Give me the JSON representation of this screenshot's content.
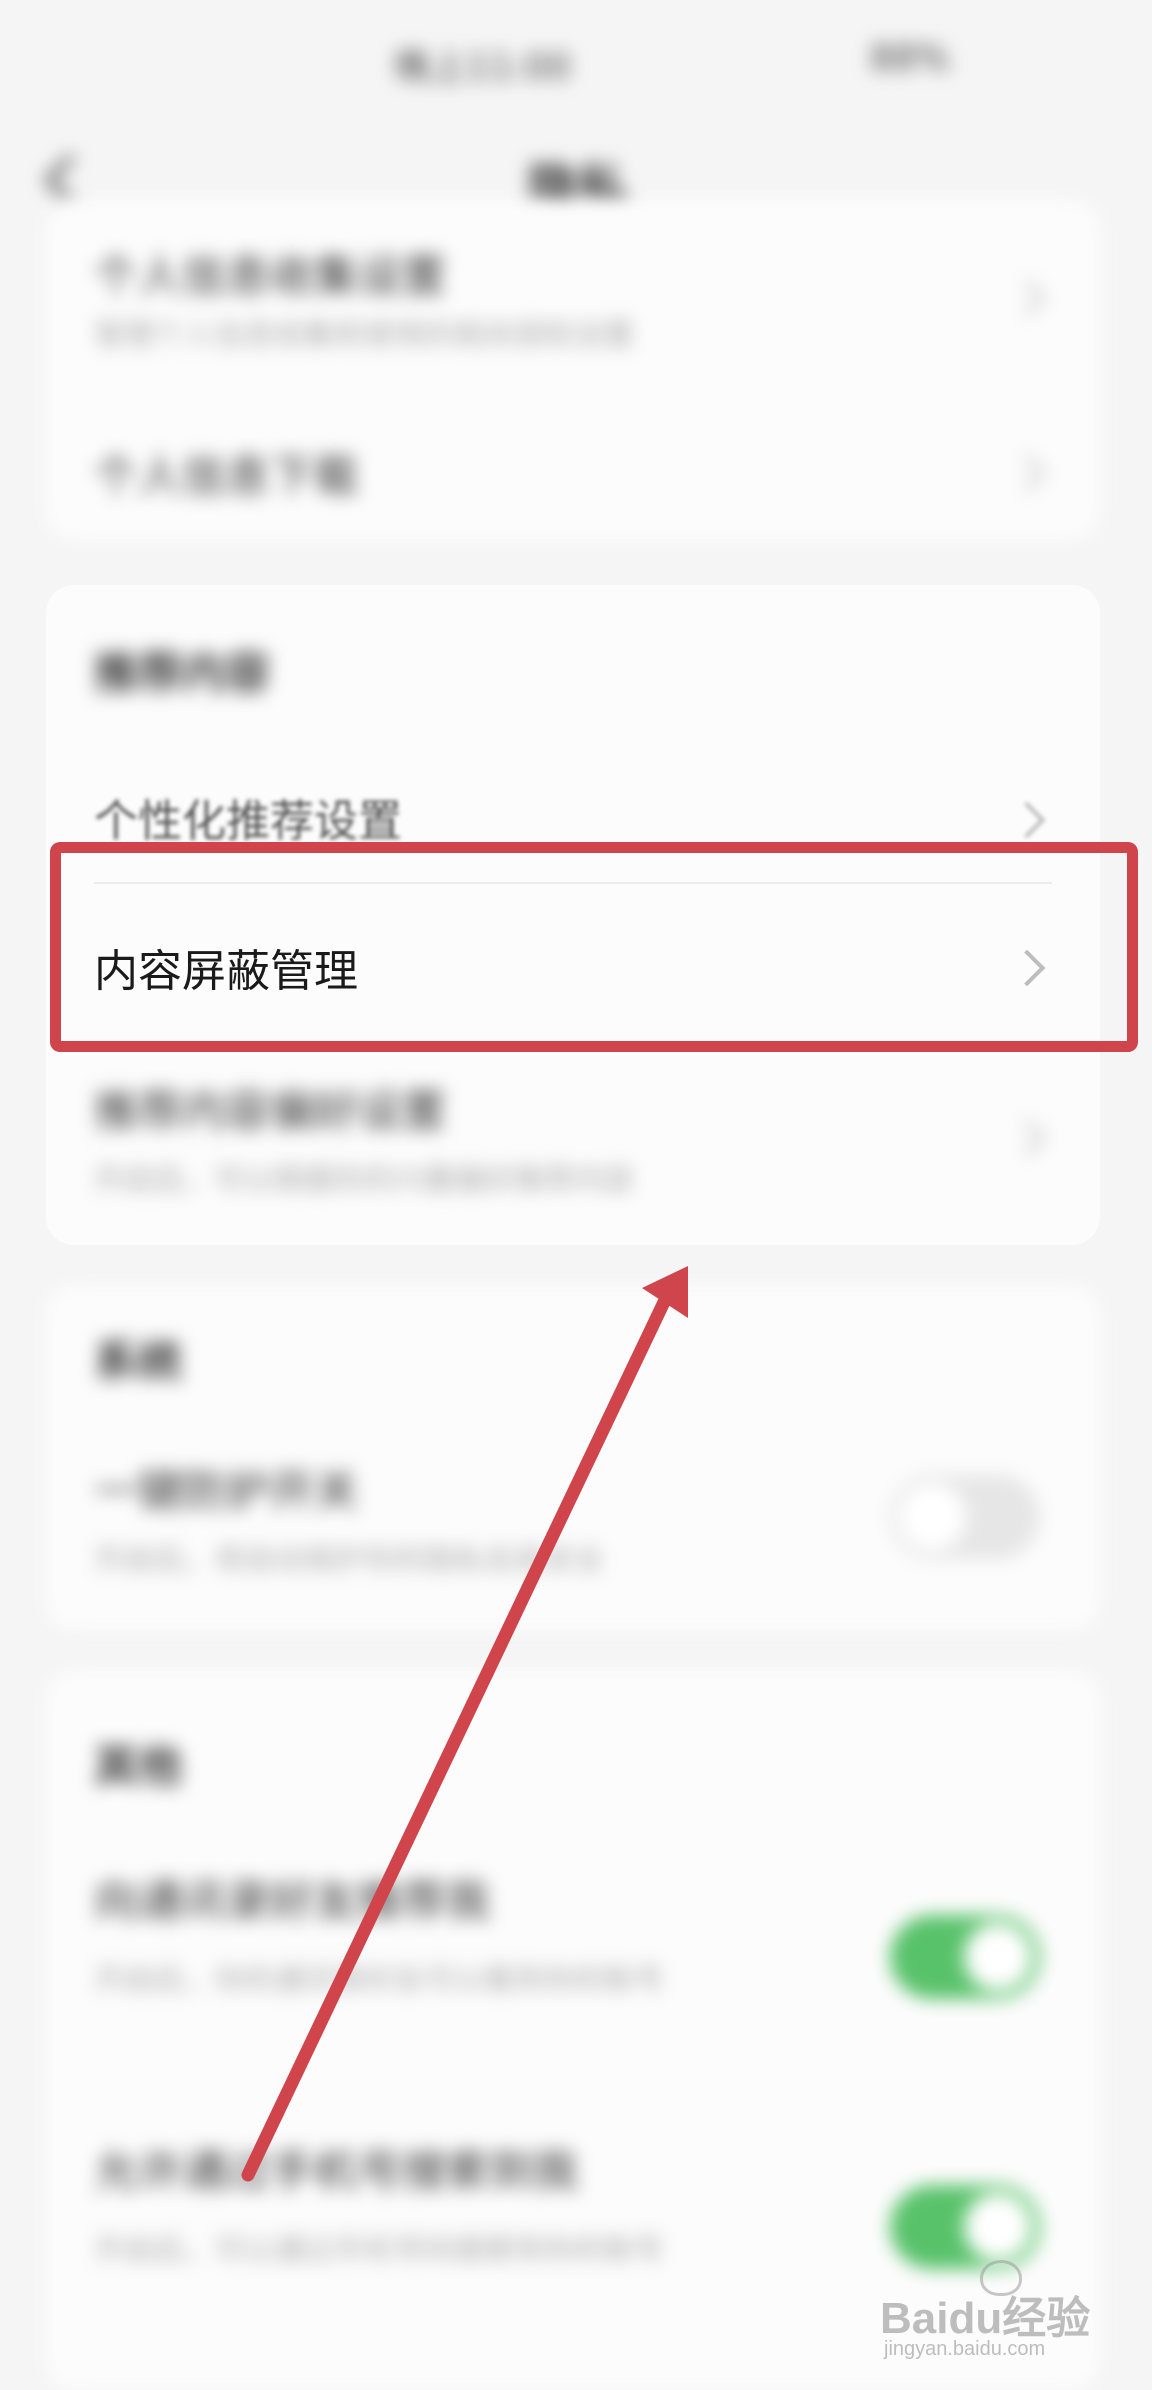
{
  "status_bar": {
    "center": "晚上11:00",
    "right": "88%"
  },
  "header": {
    "title": "隐私"
  },
  "cards": {
    "personal_info": {
      "rows": [
        {
          "title": "个人信息收集设置",
          "subtitle": "管理个人信息收集和使用的相关授权设置"
        },
        {
          "title": "个人信息下载"
        }
      ]
    },
    "recommend": {
      "heading": "推荐内容",
      "rows": [
        {
          "title": "个性化推荐设置"
        },
        {
          "title": "内容屏蔽管理"
        },
        {
          "title": "推荐内容偏好设置",
          "subtitle": "开启后，可以根据你的兴趣偏好推荐内容"
        }
      ]
    },
    "system": {
      "heading": "系统",
      "rows": [
        {
          "title": "一键防护开关",
          "subtitle": "开启后，将自动保护你的隐私信息安全"
        }
      ]
    },
    "other": {
      "heading": "其他",
      "rows": [
        {
          "title": "向通讯录好友推荐我",
          "subtitle": "开启后，你的通讯录好友可以看到你的账号"
        },
        {
          "title": "允许通过手机号搜索到我",
          "subtitle": "开启后，可以通过手机号码搜索到你的账号"
        }
      ]
    }
  },
  "toggles": {
    "one_key_protect": false,
    "recommend_to_contacts": true,
    "search_by_phone": true
  },
  "colors": {
    "highlight": "#d0454c",
    "toggle_on": "#58c26a",
    "arrow": "#d0454c"
  },
  "watermark": {
    "brand": "Baidu经验",
    "url": "jingyan.baidu.com"
  }
}
